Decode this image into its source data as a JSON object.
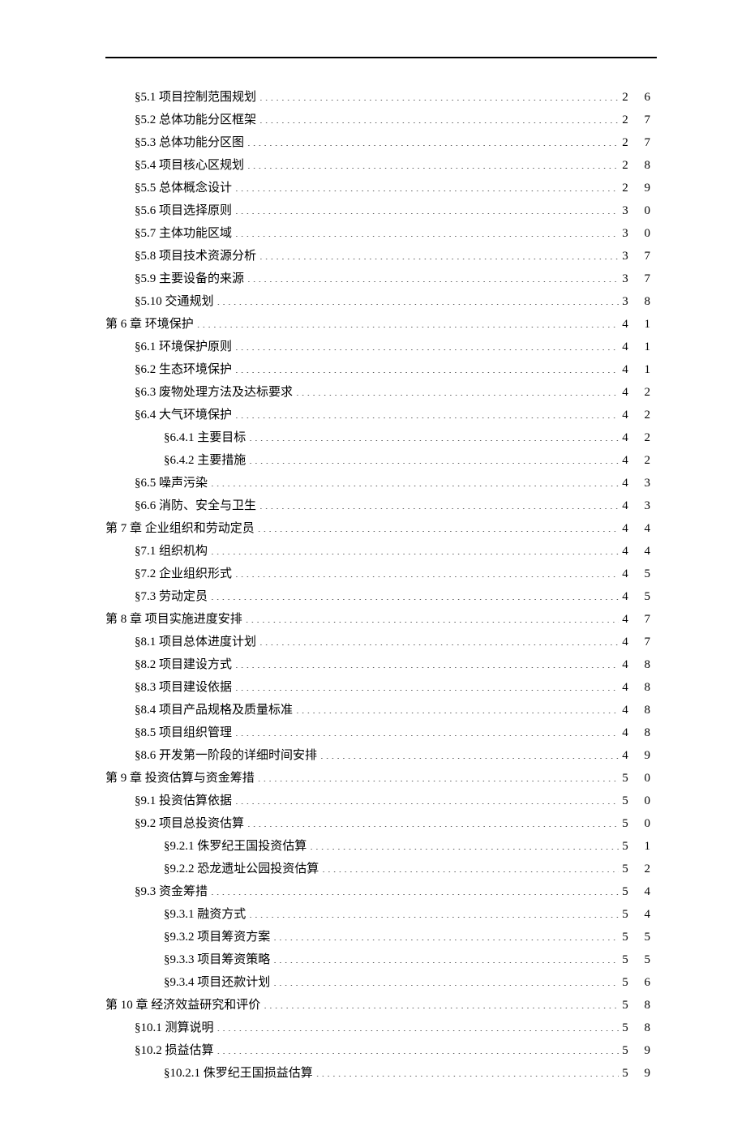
{
  "toc": [
    {
      "indent": 1,
      "label": "§5.1  项目控制范围规划",
      "page": "2 6"
    },
    {
      "indent": 1,
      "label": "§5.2  总体功能分区框架",
      "page": "2 7"
    },
    {
      "indent": 1,
      "label": "§5.3  总体功能分区图",
      "page": "2 7"
    },
    {
      "indent": 1,
      "label": "§5.4  项目核心区规划",
      "page": "2 8"
    },
    {
      "indent": 1,
      "label": "§5.5  总体概念设计",
      "page": "2 9"
    },
    {
      "indent": 1,
      "label": "§5.6  项目选择原则",
      "page": "3 0"
    },
    {
      "indent": 1,
      "label": "§5.7  主体功能区域",
      "page": "3 0"
    },
    {
      "indent": 1,
      "label": "§5.8  项目技术资源分析",
      "page": "3 7"
    },
    {
      "indent": 1,
      "label": "§5.9  主要设备的来源",
      "page": "3 7"
    },
    {
      "indent": 1,
      "label": "§5.10  交通规划",
      "page": "3 8"
    },
    {
      "indent": 0,
      "label": "第 6 章  环境保护",
      "page": "4 1"
    },
    {
      "indent": 1,
      "label": "§6.1  环境保护原则",
      "page": "4 1"
    },
    {
      "indent": 1,
      "label": "§6.2  生态环境保护",
      "page": "4 1"
    },
    {
      "indent": 1,
      "label": "§6.3  废物处理方法及达标要求",
      "page": "4 2"
    },
    {
      "indent": 1,
      "label": "§6.4  大气环境保护",
      "page": "4 2"
    },
    {
      "indent": 2,
      "label": "§6.4.1  主要目标",
      "page": "4 2"
    },
    {
      "indent": 2,
      "label": "§6.4.2  主要措施",
      "page": "4 2"
    },
    {
      "indent": 1,
      "label": "§6.5  噪声污染",
      "page": "4 3"
    },
    {
      "indent": 1,
      "label": "§6.6  消防、安全与卫生",
      "page": "4 3"
    },
    {
      "indent": 0,
      "label": "第 7 章  企业组织和劳动定员",
      "page": "4 4"
    },
    {
      "indent": 1,
      "label": "§7.1  组织机构",
      "page": "4 4"
    },
    {
      "indent": 1,
      "label": "§7.2  企业组织形式",
      "page": "4 5"
    },
    {
      "indent": 1,
      "label": "§7.3  劳动定员",
      "page": "4 5"
    },
    {
      "indent": 0,
      "label": "第 8 章  项目实施进度安排",
      "page": "4 7"
    },
    {
      "indent": 1,
      "label": "§8.1  项目总体进度计划",
      "page": "4 7"
    },
    {
      "indent": 1,
      "label": "§8.2  项目建设方式",
      "page": "4 8"
    },
    {
      "indent": 1,
      "label": "§8.3  项目建设依据",
      "page": "4 8"
    },
    {
      "indent": 1,
      "label": "§8.4  项目产品规格及质量标准",
      "page": "4 8"
    },
    {
      "indent": 1,
      "label": "§8.5  项目组织管理",
      "page": "4 8"
    },
    {
      "indent": 1,
      "label": "§8.6  开发第一阶段的详细时间安排",
      "page": "4 9"
    },
    {
      "indent": 0,
      "label": "第 9 章  投资估算与资金筹措",
      "page": "5 0"
    },
    {
      "indent": 1,
      "label": "§9.1  投资估算依据",
      "page": "5 0"
    },
    {
      "indent": 1,
      "label": "§9.2  项目总投资估算",
      "page": "5 0"
    },
    {
      "indent": 2,
      "label": "§9.2.1  侏罗纪王国投资估算",
      "page": "5 1"
    },
    {
      "indent": 2,
      "label": "§9.2.2  恐龙遗址公园投资估算",
      "page": "5 2"
    },
    {
      "indent": 1,
      "label": "§9.3  资金筹措",
      "page": "5 4"
    },
    {
      "indent": 2,
      "label": "§9.3.1  融资方式",
      "page": "5 4"
    },
    {
      "indent": 2,
      "label": "§9.3.2  项目筹资方案",
      "page": "5 5"
    },
    {
      "indent": 2,
      "label": "§9.3.3  项目筹资策略",
      "page": "5 5"
    },
    {
      "indent": 2,
      "label": "§9.3.4  项目还款计划",
      "page": "5 6"
    },
    {
      "indent": 0,
      "label": "第 10 章  经济效益研究和评价",
      "page": "5 8"
    },
    {
      "indent": 1,
      "label": "§10.1  测算说明",
      "page": "5 8"
    },
    {
      "indent": 1,
      "label": "§10.2  损益估算",
      "page": "5 9"
    },
    {
      "indent": 2,
      "label": "§10.2.1  侏罗纪王国损益估算",
      "page": "5 9"
    }
  ]
}
